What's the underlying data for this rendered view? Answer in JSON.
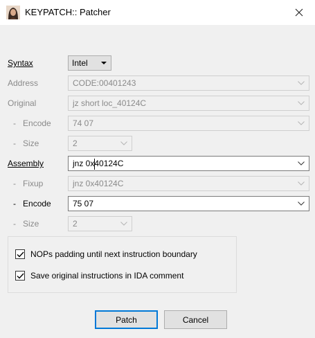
{
  "window": {
    "title": "KEYPATCH:: Patcher"
  },
  "syntax": {
    "label": "Syntax",
    "value": "Intel"
  },
  "address": {
    "label": "Address",
    "value": "CODE:00401243"
  },
  "original": {
    "label": "Original",
    "value": "jz short loc_40124C"
  },
  "original_encode": {
    "dash": "-",
    "label": "Encode",
    "value": "74 07"
  },
  "original_size": {
    "dash": "-",
    "label": "Size",
    "value": "2"
  },
  "assembly": {
    "label": "Assembly",
    "value": "jnz 0x40124C"
  },
  "fixup": {
    "dash": "-",
    "label": "Fixup",
    "value": "jnz 0x40124C"
  },
  "encode": {
    "dash": "-",
    "label": "Encode",
    "value": "75 07"
  },
  "size": {
    "dash": "-",
    "label": "Size",
    "value": "2"
  },
  "options": {
    "nops_padding": {
      "label": "NOPs padding until next instruction boundary",
      "checked": true
    },
    "save_comment": {
      "label": "Save original instructions in IDA comment",
      "checked": true
    }
  },
  "buttons": {
    "patch": "Patch",
    "cancel": "Cancel"
  },
  "colors": {
    "dialog_bg": "#f0f0f0",
    "focus_border": "#0078d7",
    "disabled_text": "#8a8a8a"
  },
  "icons": {
    "app": "avatar-icon",
    "close": "close-icon",
    "dropdown": "chevron-down-icon",
    "check": "check-icon"
  }
}
